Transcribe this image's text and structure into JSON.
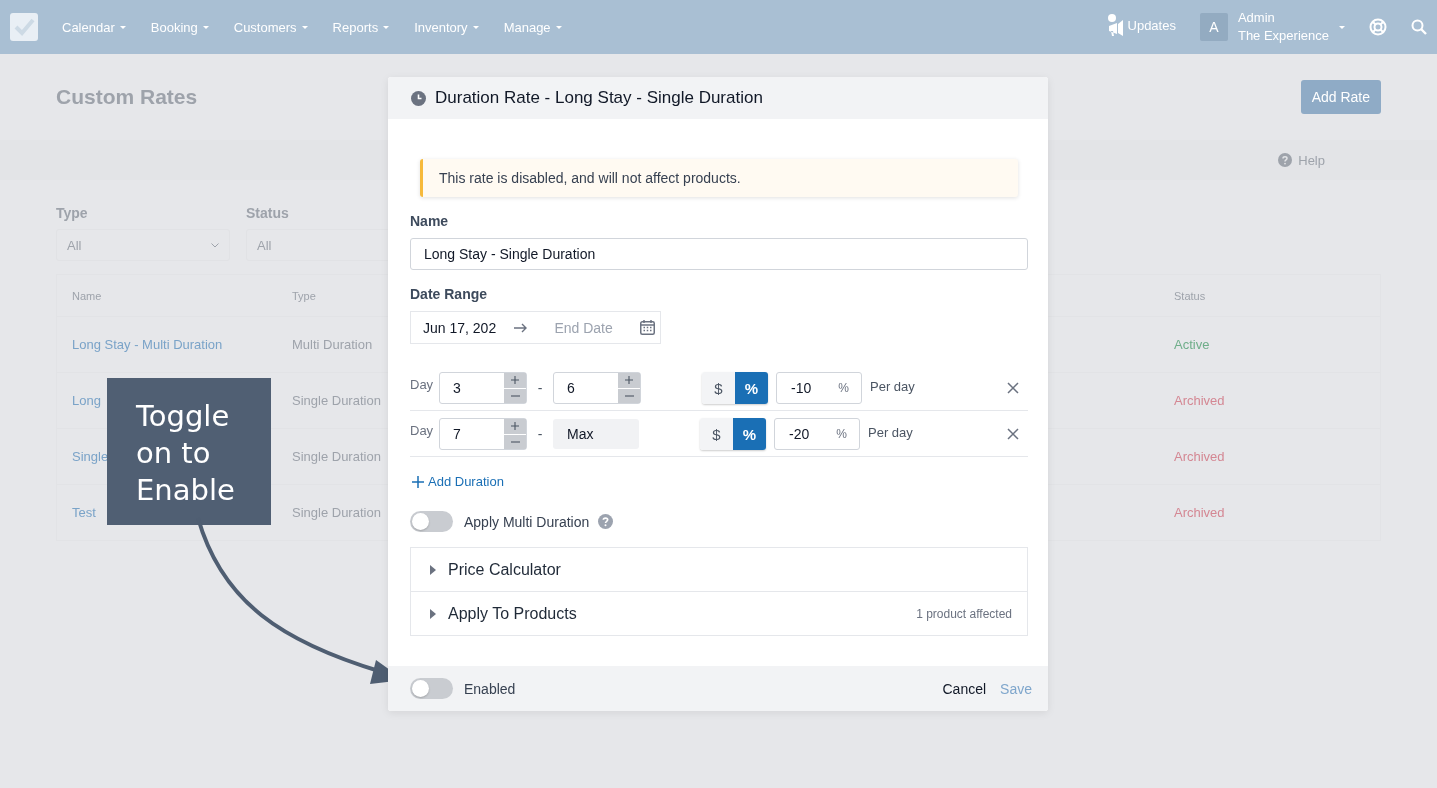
{
  "navbar": {
    "menu": [
      {
        "label": "Calendar"
      },
      {
        "label": "Booking"
      },
      {
        "label": "Customers"
      },
      {
        "label": "Reports"
      },
      {
        "label": "Inventory"
      },
      {
        "label": "Manage"
      }
    ],
    "updates": "Updates",
    "avatar": "A",
    "user": "Admin",
    "company": "The Experience"
  },
  "page": {
    "title": "Custom Rates",
    "add_button": "Add Rate",
    "help": "Help",
    "filters": [
      {
        "label": "Type",
        "value": "All"
      },
      {
        "label": "Status",
        "value": "All"
      }
    ],
    "table": {
      "columns": [
        "Name",
        "Type",
        "Status"
      ],
      "rows": [
        {
          "name": "Long Stay - Multi Duration",
          "type": "Multi Duration",
          "status": "Active",
          "color": "#6fae8a"
        },
        {
          "name": "Long",
          "type": "Single Duration",
          "status": "Archived",
          "color": "#d48793"
        },
        {
          "name": "Single",
          "type": "Single Duration",
          "status": "Archived",
          "color": "#d48793"
        },
        {
          "name": "Test",
          "type": "Single Duration",
          "status": "Archived",
          "color": "#d48793"
        }
      ]
    }
  },
  "modal": {
    "title": "Duration Rate - Long Stay - Single Duration",
    "alert": "This rate is disabled, and will not affect products.",
    "name_label": "Name",
    "name_value": "Long Stay - Single Duration",
    "date_label": "Date Range",
    "start_date": "Jun 17, 202",
    "end_placeholder": "End Date",
    "durations": [
      {
        "prefix": "Day",
        "from": "3",
        "separator": "-",
        "to": {
          "kind": "stepper",
          "value": "6"
        },
        "units": [
          {
            "label": "$",
            "selected": false
          },
          {
            "label": "%",
            "selected": true
          }
        ],
        "amount": "-10",
        "amount_unit": "%",
        "period": "Per day"
      },
      {
        "prefix": "Day",
        "from": "7",
        "separator": "-",
        "to": {
          "kind": "fixed",
          "value": "Max"
        },
        "units": [
          {
            "label": "$",
            "selected": false
          },
          {
            "label": "%",
            "selected": true
          }
        ],
        "amount": "-20",
        "amount_unit": "%",
        "period": "Per day"
      }
    ],
    "add_duration": "Add Duration",
    "multi_toggle": {
      "label": "Apply Multi Duration",
      "on": false
    },
    "sections": [
      {
        "label": "Price Calculator",
        "expanded": false
      },
      {
        "label": "Apply To Products",
        "expanded": false,
        "note": "1 product affected"
      }
    ],
    "footer": {
      "toggle": {
        "label": "Enabled",
        "on": false
      },
      "cancel": "Cancel",
      "save": {
        "label": "Save",
        "disabled": true
      }
    }
  },
  "callout": {
    "text": "Toggle on to Enable"
  }
}
